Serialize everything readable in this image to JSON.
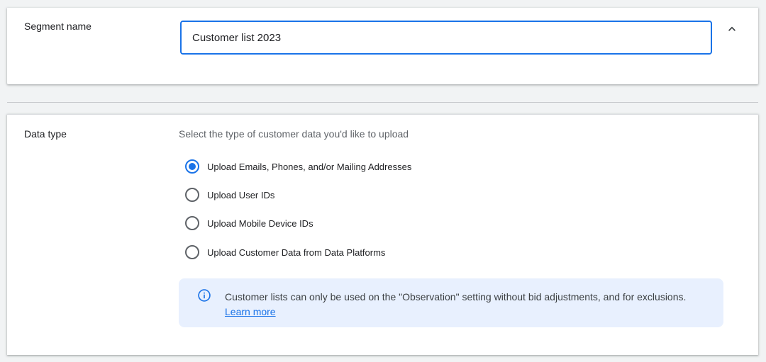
{
  "segment": {
    "label": "Segment name",
    "input_value": "Customer list 2023",
    "collapse_icon": "chevron-up-icon"
  },
  "data_type": {
    "label": "Data type",
    "hint": "Select the type of customer data you'd like to upload",
    "options": [
      {
        "label": "Upload Emails, Phones, and/or Mailing Addresses",
        "checked": true
      },
      {
        "label": "Upload User IDs",
        "checked": false
      },
      {
        "label": "Upload Mobile Device IDs",
        "checked": false
      },
      {
        "label": "Upload Customer Data from Data Platforms",
        "checked": false
      }
    ],
    "info": {
      "icon": "info-icon",
      "text": "Customer lists can only be used on the \"Observation\" setting without bid adjustments, and for exclusions.",
      "link": "Learn more"
    }
  },
  "colors": {
    "accent": "#1a73e8",
    "info_background": "#e8f0fe",
    "page_background": "#f1f3f4"
  }
}
